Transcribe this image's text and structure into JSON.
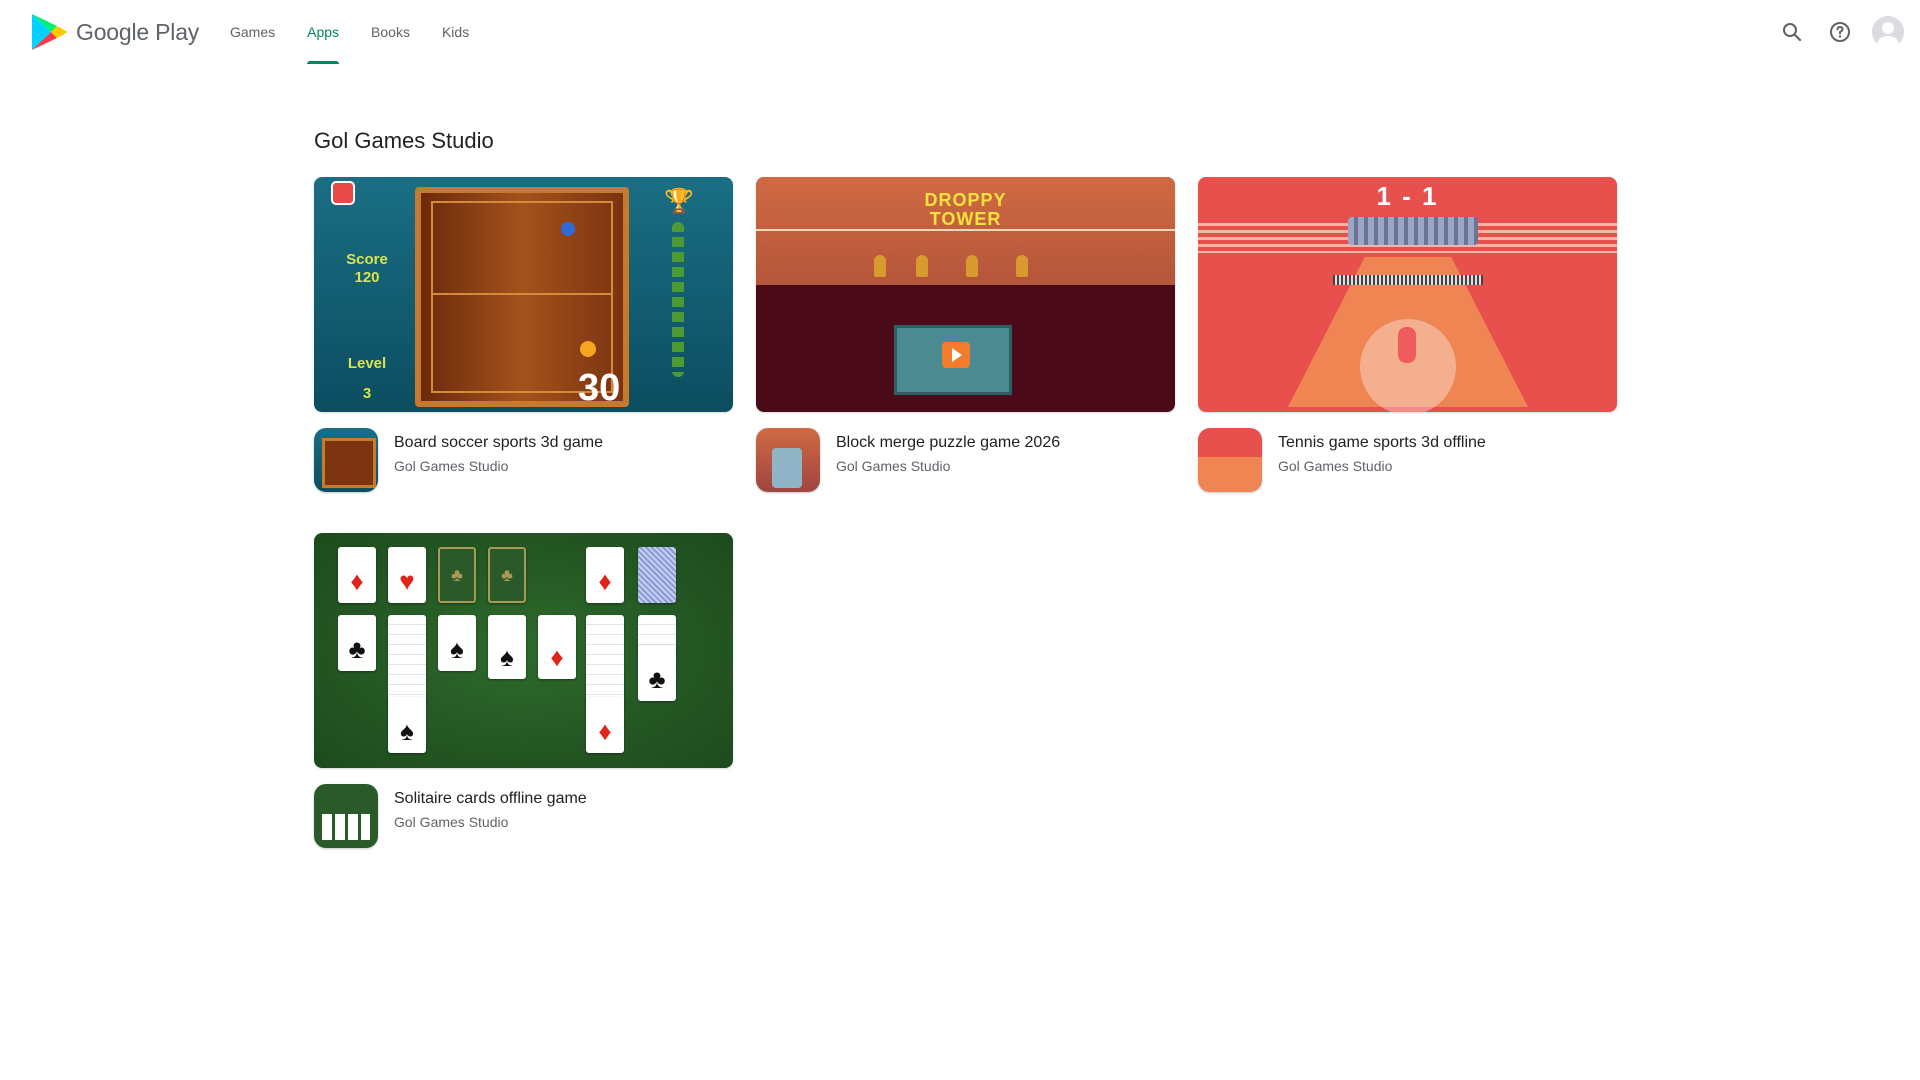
{
  "header": {
    "logo_text": "Google Play",
    "tabs": [
      {
        "label": "Games",
        "active": false
      },
      {
        "label": "Apps",
        "active": true
      },
      {
        "label": "Books",
        "active": false
      },
      {
        "label": "Kids",
        "active": false
      }
    ],
    "icons": [
      "search-icon",
      "help-icon",
      "account-avatar"
    ]
  },
  "page": {
    "title": "Gol Games Studio"
  },
  "apps": [
    {
      "name": "Board soccer sports 3d game",
      "developer": "Gol Games Studio",
      "banner": {
        "score_label": "Score",
        "score_value": "120",
        "level_label": "Level",
        "level_value": "3",
        "big_number": "30"
      }
    },
    {
      "name": "Block merge puzzle game 2026",
      "developer": "Gol Games Studio",
      "banner": {
        "title_line1": "DROPPY",
        "title_line2": "TOWER"
      }
    },
    {
      "name": "Tennis game sports 3d offline",
      "developer": "Gol Games Studio",
      "banner": {
        "score": "1 - 1"
      }
    },
    {
      "name": "Solitaire cards offline game",
      "developer": "Gol Games Studio",
      "banner": {}
    }
  ],
  "colors": {
    "accent": "#01875f",
    "text_primary": "#202124",
    "text_secondary": "#5f6368"
  }
}
